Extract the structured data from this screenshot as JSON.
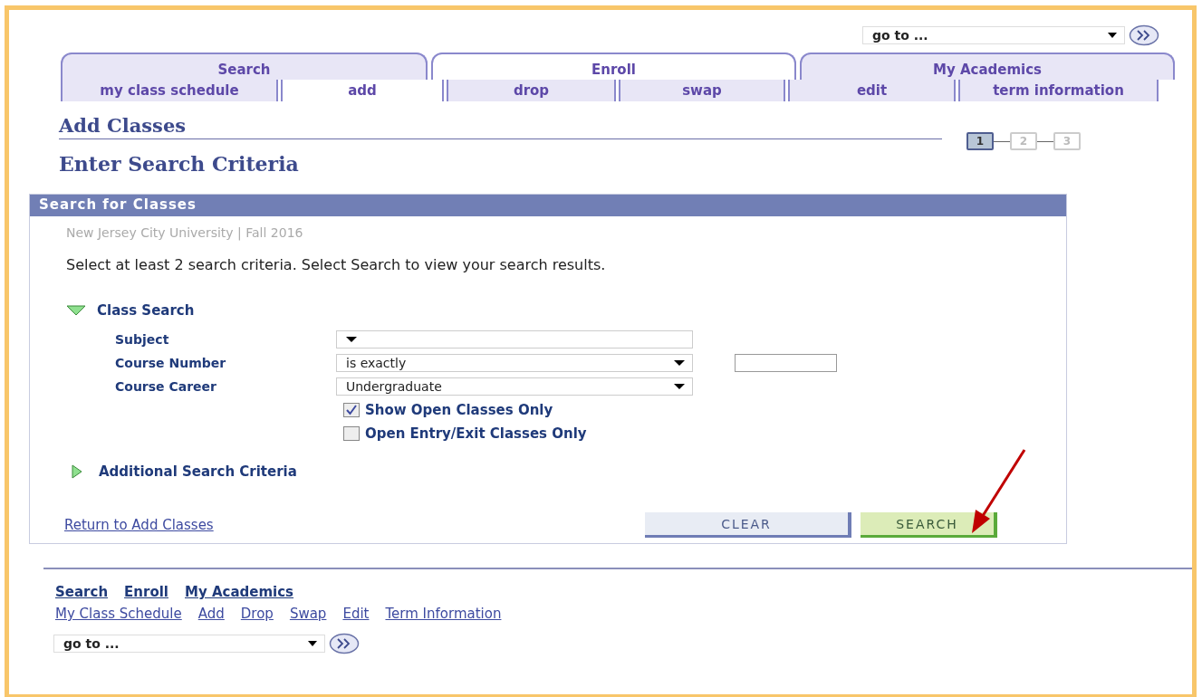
{
  "goto_top": {
    "value": "go to ..."
  },
  "tabs": [
    {
      "label": "Search",
      "selected": false
    },
    {
      "label": "Enroll",
      "selected": true
    },
    {
      "label": "My Academics",
      "selected": false
    }
  ],
  "subtabs": [
    {
      "label": "my class schedule",
      "selected": false
    },
    {
      "label": "add",
      "selected": true
    },
    {
      "label": "drop",
      "selected": false
    },
    {
      "label": "swap",
      "selected": false
    },
    {
      "label": "edit",
      "selected": false
    },
    {
      "label": "term information",
      "selected": false
    }
  ],
  "page_title": "Add Classes",
  "steps": [
    {
      "label": "1",
      "selected": true
    },
    {
      "label": "2",
      "selected": false
    },
    {
      "label": "3",
      "selected": false
    }
  ],
  "subtitle": "Enter Search Criteria",
  "panel": {
    "title": "Search for Classes",
    "institution": "New Jersey City University | Fall 2016",
    "instructions": "Select at least 2 search criteria. Select Search to view your search results.",
    "class_search": {
      "label": "Class Search",
      "expanded": true,
      "fields": [
        {
          "label": "Subject",
          "kind": "select"
        },
        {
          "label": "Course Number",
          "kind": "select-text",
          "value": "is exactly"
        },
        {
          "label": "Course Career",
          "kind": "select",
          "value": "Undergraduate"
        }
      ],
      "checkboxes": [
        {
          "label": "Show Open Classes Only",
          "checked": true
        },
        {
          "label": "Open Entry/Exit Classes Only",
          "checked": false
        }
      ]
    },
    "additional_criteria": {
      "label": "Additional Search Criteria",
      "expanded": false
    },
    "return_link": "Return to Add Classes",
    "buttons": [
      {
        "label": "CLEAR",
        "kind": "clear"
      },
      {
        "label": "SEARCH",
        "kind": "search"
      }
    ]
  },
  "footer": {
    "primary_links": [
      "Search",
      "Enroll",
      "My Academics"
    ],
    "secondary_links": [
      "My Class Schedule",
      "Add",
      "Drop",
      "Swap",
      "Edit",
      "Term Information"
    ],
    "goto": {
      "value": "go to ..."
    }
  }
}
